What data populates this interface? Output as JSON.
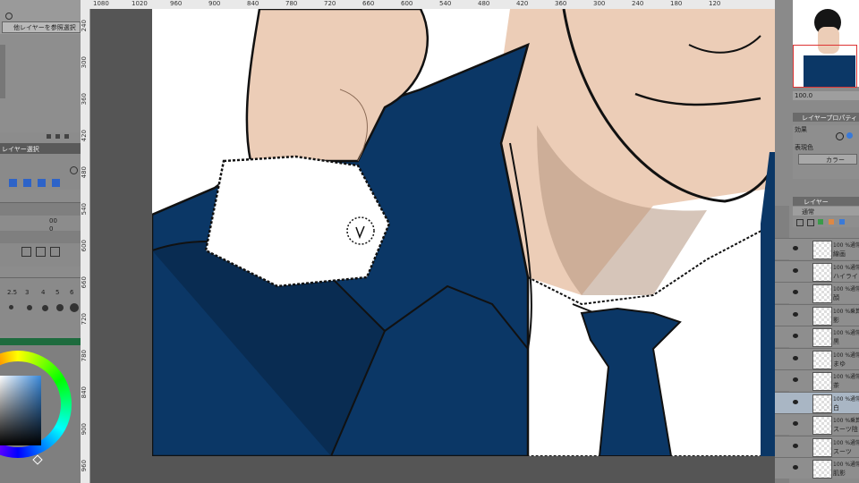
{
  "left_panel": {
    "ref_layer_button": "他レイヤーを参照選択",
    "layer_ref_label": "レイヤー選択",
    "brush_sizes": [
      "2.5",
      "3",
      "4",
      "5",
      "6"
    ],
    "value_00": "00",
    "value_0": "0"
  },
  "ruler_top_labels": [
    "1080",
    "1020",
    "960",
    "900",
    "840",
    "780",
    "720",
    "660",
    "600",
    "540",
    "480",
    "420",
    "360",
    "300",
    "240",
    "180",
    "120"
  ],
  "ruler_left_labels": [
    "240",
    "300",
    "360",
    "420",
    "480",
    "540",
    "600",
    "660",
    "720",
    "780",
    "840",
    "900",
    "960"
  ],
  "canvas": {
    "accent_suit": "#0b3766",
    "accent_skin": "#eccdb7",
    "shirt": "#ffffff"
  },
  "right_panel": {
    "zoom_value": "100.0",
    "tab_layer_property": "レイヤープロパティ",
    "effect_label": "効果",
    "expression_color_label": "表現色",
    "expression_color_value": "カラー",
    "tab_layer": "レイヤー",
    "blend_mode": "通常",
    "layers": [
      {
        "prop": "100 %通常",
        "name": "線画"
      },
      {
        "prop": "100 %通常",
        "name": "ハイライト"
      },
      {
        "prop": "100 %通常",
        "name": "顔"
      },
      {
        "prop": "100 %乗算",
        "name": "影"
      },
      {
        "prop": "100 %通常",
        "name": "黒"
      },
      {
        "prop": "100 %通常",
        "name": "まゆ"
      },
      {
        "prop": "100 %通常",
        "name": "茶"
      },
      {
        "prop": "100 %通常",
        "name": "白"
      },
      {
        "prop": "100 %乗算",
        "name": "スーツ陰"
      },
      {
        "prop": "100 %通常",
        "name": "スーツ"
      },
      {
        "prop": "100 %通常",
        "name": "肌影"
      }
    ]
  }
}
